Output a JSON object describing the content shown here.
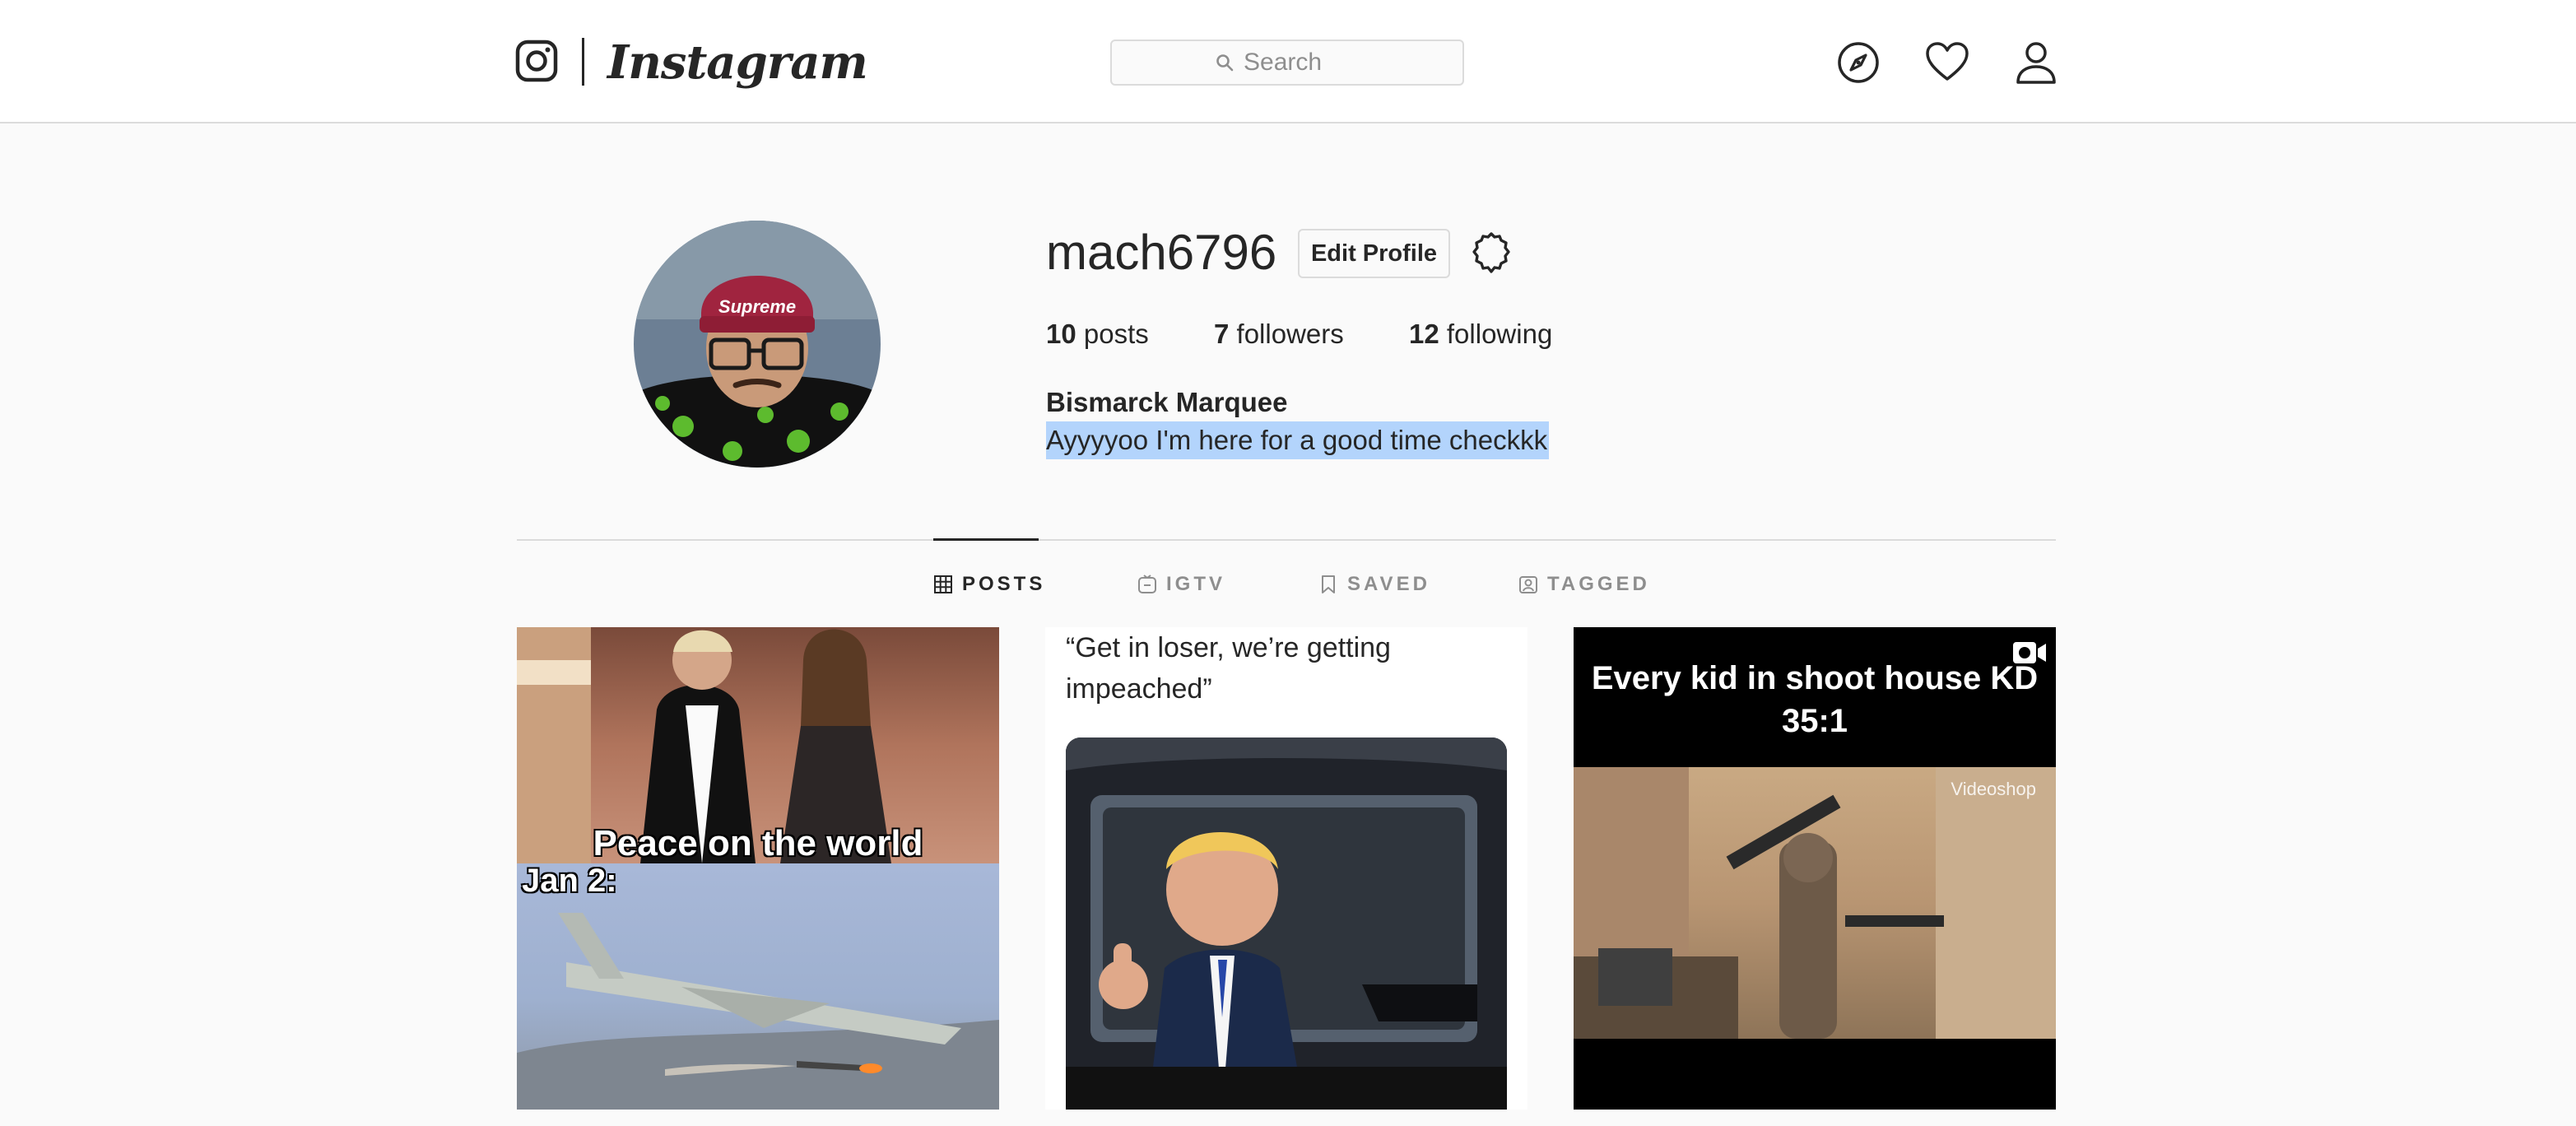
{
  "header": {
    "logo_text": "Instagram",
    "search_placeholder": "Search",
    "icons": [
      "instagram-glyph-icon",
      "search-icon",
      "explore-compass-icon",
      "activity-heart-icon",
      "profile-user-icon"
    ]
  },
  "profile": {
    "username": "mach6796",
    "edit_button": "Edit Profile",
    "settings_icon": "gear-icon",
    "stats": {
      "posts_count": "10",
      "posts_label": "posts",
      "followers_count": "7",
      "followers_label": "followers",
      "following_count": "12",
      "following_label": "following"
    },
    "full_name": "Bismarck Marquee",
    "bio": "Ayyyyoo I'm here for a good time checkkk"
  },
  "tabs": [
    {
      "label": "POSTS",
      "icon": "grid-icon",
      "active": true
    },
    {
      "label": "IGTV",
      "icon": "igtv-icon",
      "active": false
    },
    {
      "label": "SAVED",
      "icon": "bookmark-icon",
      "active": false
    },
    {
      "label": "TAGGED",
      "icon": "tagged-icon",
      "active": false
    }
  ],
  "posts": [
    {
      "caption_top": "Peace on the world",
      "caption_bottom": "Jan 2:"
    },
    {
      "text": "“Get in loser, we’re getting impeached”"
    },
    {
      "title": "Every kid in shoot house KD 35:1",
      "watermark": "Videoshop",
      "badge": "video-camera-icon"
    }
  ],
  "colors": {
    "background": "#fafafa",
    "header_bg": "#ffffff",
    "border": "#dbdbdb",
    "text": "#262626",
    "muted": "#8e8e8e",
    "selection": "#b3d4fc"
  }
}
